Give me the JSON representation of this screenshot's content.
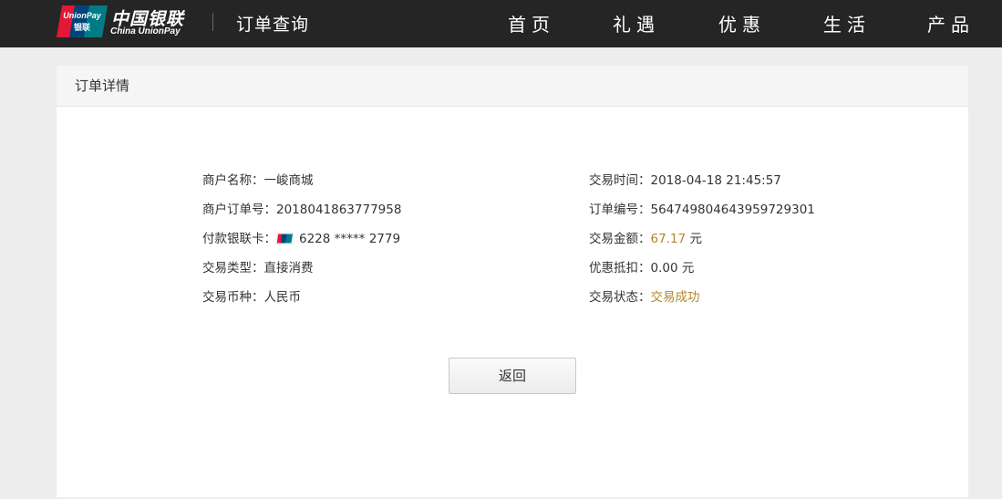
{
  "header": {
    "brand_cn": "中国银联",
    "brand_en": "China UnionPay",
    "logo_text_top": "UnionPay",
    "logo_text_bottom": "银联",
    "page_title": "订单查询",
    "nav": [
      "首页",
      "礼遇",
      "优惠",
      "生活",
      "产品"
    ]
  },
  "panel": {
    "title": "订单详情",
    "left": [
      {
        "label": "商户名称：",
        "value": "一峻商城"
      },
      {
        "label": "商户订单号：",
        "value": "2018041863777958"
      },
      {
        "label": "付款银联卡：",
        "value": "6228 ***** 2779",
        "icon": "unionpay-card-icon"
      },
      {
        "label": "交易类型：",
        "value": "直接消费"
      },
      {
        "label": "交易币种：",
        "value": "人民币"
      }
    ],
    "right": [
      {
        "label": "交易时间：",
        "value": "2018-04-18 21:45:57"
      },
      {
        "label": "订单编号：",
        "value": "564749804643959729301"
      },
      {
        "label": "交易金额：",
        "amount": "67.17",
        "unit": " 元"
      },
      {
        "label": "优惠抵扣：",
        "value": "0.00 元"
      },
      {
        "label": "交易状态：",
        "value": "交易成功"
      }
    ],
    "back_button": "返回"
  },
  "colors": {
    "topbar": "#252525",
    "accent": "#b3862a",
    "background": "#ededed"
  }
}
